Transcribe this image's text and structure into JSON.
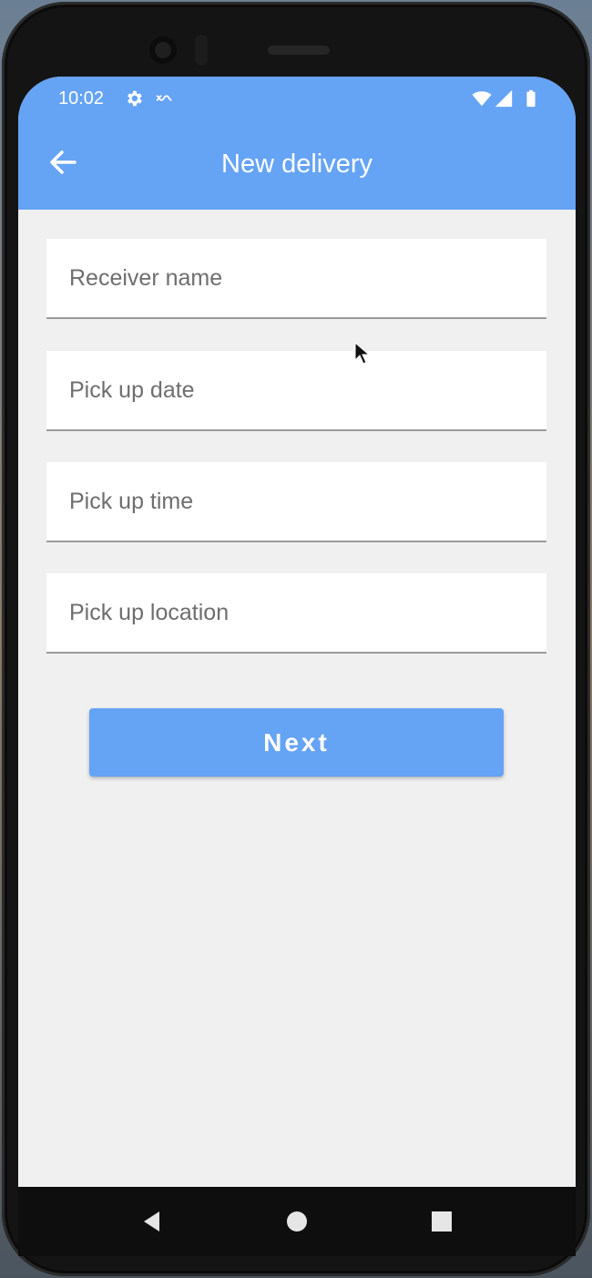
{
  "status_bar": {
    "time": "10:02",
    "icons": [
      "gear-icon",
      "signal-dots-icon",
      "wifi-icon",
      "cellular-icon",
      "battery-icon"
    ]
  },
  "app_bar": {
    "title": "New delivery",
    "back_icon": "arrow-left-icon",
    "color": "#65a3f5"
  },
  "form": {
    "fields": [
      {
        "name": "receiver-name",
        "placeholder": "Receiver name",
        "value": ""
      },
      {
        "name": "pick-up-date",
        "placeholder": "Pick up date",
        "value": ""
      },
      {
        "name": "pick-up-time",
        "placeholder": "Pick up time",
        "value": ""
      },
      {
        "name": "pick-up-location",
        "placeholder": "Pick up location",
        "value": ""
      }
    ],
    "submit_label": "Next"
  },
  "nav_bar": {
    "icons": [
      "back-triangle-icon",
      "home-circle-icon",
      "recents-square-icon"
    ]
  },
  "colors": {
    "accent": "#65a3f5",
    "background": "#f0f0f0",
    "field_background": "#ffffff"
  }
}
